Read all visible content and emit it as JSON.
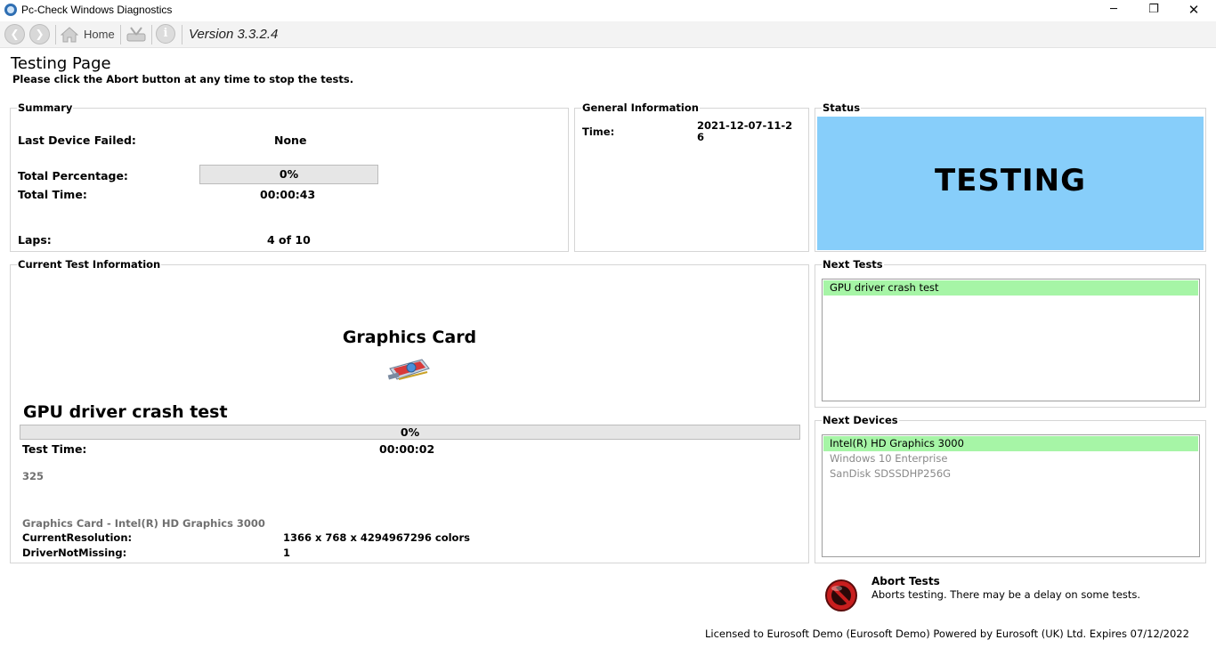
{
  "window": {
    "title": "Pc-Check Windows Diagnostics",
    "minimize": "─",
    "maximize": "❐",
    "close": "✕"
  },
  "toolbar": {
    "back_icon": "back-arrow-icon",
    "forward_icon": "forward-arrow-icon",
    "home_label": "Home",
    "tools_icon": "tools-icon",
    "info_icon": "info-icon",
    "version": "Version 3.3.2.4"
  },
  "page": {
    "title": "Testing Page",
    "subtitle": "Please click the Abort button at any time to stop the tests."
  },
  "summary": {
    "title": "Summary",
    "last_device_failed_label": "Last Device Failed:",
    "last_device_failed_value": "None",
    "total_percentage_label": "Total Percentage:",
    "total_percentage_text": "0%",
    "total_percentage_value": 0,
    "total_time_label": "Total Time:",
    "total_time_value": "00:00:43",
    "laps_label": "Laps:",
    "laps_value": "4 of 10"
  },
  "general": {
    "title": "General Information",
    "time_label": "Time:",
    "time_line1": "2021-12-07-11-2",
    "time_line2": "6"
  },
  "status": {
    "title": "Status",
    "text": "TESTING",
    "color": "#87cefa"
  },
  "current_test": {
    "title": "Current Test Information",
    "device_name": "Graphics Card",
    "device_icon": "graphics-card-icon",
    "test_name": "GPU driver crash test",
    "progress_text": "0%",
    "progress_value": 0,
    "test_time_label": "Test Time:",
    "test_time_value": "00:00:02",
    "counter": "325",
    "device_detail": "Graphics Card - Intel(R) HD Graphics 3000",
    "resolution_label": "CurrentResolution:",
    "resolution_value": "1366 x 768 x 4294967296 colors",
    "driver_label": "DriverNotMissing:",
    "driver_value": "1"
  },
  "next_tests": {
    "title": "Next Tests",
    "items": [
      "GPU driver crash test"
    ]
  },
  "next_devices": {
    "title": "Next Devices",
    "items": [
      "Intel(R) HD Graphics 3000",
      "Windows 10 Enterprise",
      "SanDisk SDSSDHP256G"
    ]
  },
  "abort": {
    "title": "Abort Tests",
    "description": "Aborts testing. There may be a delay on some tests.",
    "icon": "abort-icon"
  },
  "footer": "Licensed to Eurosoft Demo (Eurosoft Demo) Powered by Eurosoft (UK) Ltd.  Expires 07/12/2022"
}
